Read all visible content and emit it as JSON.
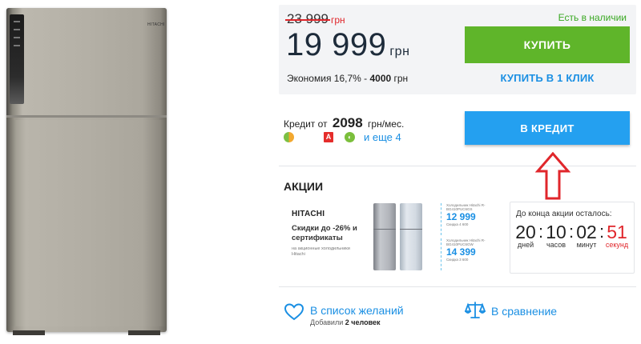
{
  "product_image": {
    "brand_mark": "HITACHI"
  },
  "price": {
    "old_value": "23 999",
    "old_currency": "грн",
    "new_value": "19 999",
    "new_currency": "грн",
    "savings_prefix": "Экономия 16,7% - ",
    "savings_amount": "4000",
    "savings_currency": " грн",
    "availability": "Есть в наличии",
    "buy_label": "КУПИТЬ",
    "one_click_label": "КУПИТЬ В 1 КЛИК"
  },
  "credit": {
    "prefix": "Кредит от",
    "amount": "2098",
    "suffix": "грн/мес.",
    "bank_2_letter": "A",
    "bank_3_letter": "◐",
    "more_label": "и еще 4",
    "button_label": "В КРЕДИТ"
  },
  "promo": {
    "title": "АКЦИИ",
    "banner": {
      "logo": "HITACHI",
      "headline": "Скидки до -26% и сертификаты",
      "subtext": "на акционные холодильники Hitachi",
      "card_1_model": "Холодильник Hitachi R-BG410PUC6GS",
      "card_1_price": "12 999",
      "card_1_save": "Скидка 4 600",
      "card_2_model": "Холодильник Hitachi R-BG410PUC6GW",
      "card_2_price": "14 399",
      "card_2_save": "Скидка 3 600"
    },
    "countdown": {
      "label": "До конца акции осталось:",
      "days": "20",
      "hours": "10",
      "minutes": "02",
      "seconds": "51",
      "days_label": "дней",
      "hours_label": "часов",
      "minutes_label": "минут",
      "seconds_label": "секунд"
    }
  },
  "wishlist": {
    "label": "В список желаний",
    "count_prefix": "Добавили ",
    "count_value": "2 человек"
  },
  "compare": {
    "label": "В сравнение"
  },
  "colors": {
    "buy_green": "#5fb52a",
    "credit_blue": "#24a0f0",
    "link_blue": "#1a8fe3",
    "alert_red": "#e0262b"
  }
}
